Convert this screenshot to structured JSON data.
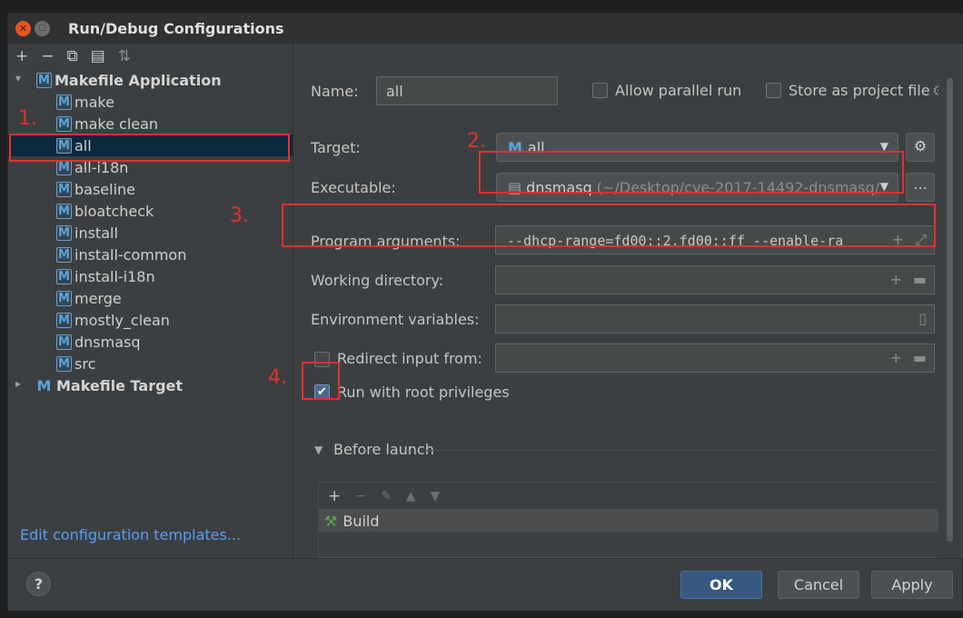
{
  "window": {
    "title": "Run/Debug Configurations"
  },
  "toolbar": {
    "add": "+",
    "remove": "−",
    "copy": "⧉",
    "folder": "▤",
    "sort": "⇅"
  },
  "tree": {
    "group_label": "Makefile Application",
    "items": [
      {
        "label": "make"
      },
      {
        "label": "make clean"
      },
      {
        "label": "all"
      },
      {
        "label": "all-i18n"
      },
      {
        "label": "baseline"
      },
      {
        "label": "bloatcheck"
      },
      {
        "label": "install"
      },
      {
        "label": "install-common"
      },
      {
        "label": "install-i18n"
      },
      {
        "label": "merge"
      },
      {
        "label": "mostly_clean"
      },
      {
        "label": "dnsmasq"
      },
      {
        "label": "src"
      }
    ],
    "group2_label": "Makefile Target",
    "selected": "all",
    "m_icon": "M"
  },
  "edit_templates": "Edit configuration templates...",
  "form": {
    "name_label": "Name:",
    "name_value": "all",
    "allow_parallel": "Allow parallel run",
    "store_project": "Store as project file",
    "target_label": "Target:",
    "target_value": "all",
    "executable_label": "Executable:",
    "executable_name": "dnsmasq",
    "executable_path": "(~/Desktop/cve-2017-14492-dnsmasq/",
    "browse": "...",
    "args_label": "Program arguments:",
    "args_value": "--dhcp-range=fd00::2,fd00::ff --enable-ra",
    "workdir_label": "Working directory:",
    "env_label": "Environment variables:",
    "redirect_label": "Redirect input from:",
    "root_label": "Run with root privileges",
    "root_checked": true
  },
  "annotations": [
    "1.",
    "2.",
    "3.",
    "4."
  ],
  "before_launch": {
    "title": "Before launch",
    "tools": {
      "add": "+",
      "remove": "−",
      "edit": "✎",
      "up": "▲",
      "down": "▼"
    },
    "items": [
      {
        "label": "Build"
      }
    ]
  },
  "footer": {
    "help": "?",
    "ok": "OK",
    "cancel": "Cancel",
    "apply": "Apply"
  },
  "colors": {
    "accent": "#365880",
    "link": "#589df6",
    "annotation": "#e0312e",
    "selection": "#0d293e"
  }
}
